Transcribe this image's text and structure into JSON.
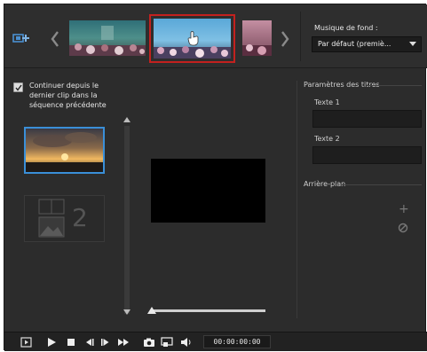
{
  "colors": {
    "panel_bg": "#2c2c2c",
    "selected_thumb_border": "#c3211f",
    "selected_clip_border": "#3a8fd8",
    "input_bg": "#1e1e1e"
  },
  "template_strip": {
    "add_icon": "add-template-icon",
    "prev_icon": "chevron-left-icon",
    "next_icon": "chevron-right-icon",
    "thumbnails": [
      {
        "selected": false
      },
      {
        "selected": true
      },
      {
        "selected": false
      }
    ]
  },
  "music": {
    "label": "Musique de fond :",
    "selected": "Par défaut (premiè..."
  },
  "continue_option": {
    "checked": true,
    "line1": "Continuer depuis le",
    "line2": "dernier clip dans la",
    "line3": "séquence précédente"
  },
  "clip_slots": [
    {
      "selected": true
    },
    {
      "selected": false,
      "number": "2"
    }
  ],
  "titles": {
    "section_label": "Paramètres des titres",
    "text1_label": "Texte 1",
    "text1_value": "",
    "text2_label": "Texte 2",
    "text2_value": ""
  },
  "background": {
    "section_label": "Arrière-plan",
    "add_symbol": "+"
  },
  "transport": {
    "buttons": [
      "play-mode-icon",
      "play-icon",
      "stop-icon",
      "previous-frame-icon",
      "next-frame-icon",
      "fast-forward-icon",
      "snapshot-icon",
      "fullscreen-icon",
      "volume-icon"
    ],
    "timecode": "00:00:00:00"
  }
}
